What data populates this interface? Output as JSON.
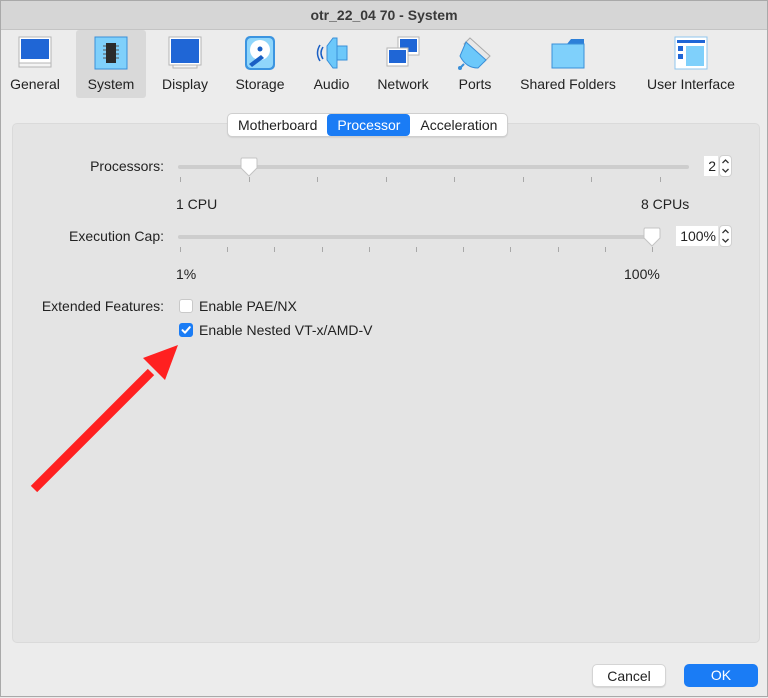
{
  "window": {
    "title": "otr_22_04 70 - System"
  },
  "toolbar": {
    "items": [
      {
        "label": "General",
        "icon": "general-monitor-icon",
        "active": false
      },
      {
        "label": "System",
        "icon": "system-chip-icon",
        "active": true
      },
      {
        "label": "Display",
        "icon": "display-monitor-icon",
        "active": false
      },
      {
        "label": "Storage",
        "icon": "storage-disk-icon",
        "active": false
      },
      {
        "label": "Audio",
        "icon": "audio-speaker-icon",
        "active": false
      },
      {
        "label": "Network",
        "icon": "network-monitors-icon",
        "active": false
      },
      {
        "label": "Ports",
        "icon": "ports-connector-icon",
        "active": false
      },
      {
        "label": "Shared Folders",
        "icon": "folder-icon",
        "active": false
      },
      {
        "label": "User Interface",
        "icon": "user-interface-window-icon",
        "active": false
      }
    ]
  },
  "tabs": [
    {
      "label": "Motherboard",
      "active": false
    },
    {
      "label": "Processor",
      "active": true
    },
    {
      "label": "Acceleration",
      "active": false
    }
  ],
  "processor": {
    "processors": {
      "label": "Processors:",
      "value": "2",
      "min_label": "1 CPU",
      "max_label": "8 CPUs",
      "min": 1,
      "max": 8,
      "current": 2
    },
    "execution_cap": {
      "label": "Execution Cap:",
      "value": "100%",
      "min_label": "1%",
      "max_label": "100%",
      "min": 1,
      "max": 100,
      "current": 100
    },
    "extended_features": {
      "label": "Extended Features:",
      "options": [
        {
          "label": "Enable PAE/NX",
          "checked": false
        },
        {
          "label": "Enable Nested VT-x/AMD-V",
          "checked": true
        }
      ]
    }
  },
  "annotation": {
    "type": "arrow",
    "color": "#ff2020",
    "points_to": "Enable Nested VT-x/AMD-V"
  },
  "buttons": {
    "cancel": "Cancel",
    "ok": "OK"
  },
  "colors": {
    "accent": "#1a7cf5"
  }
}
